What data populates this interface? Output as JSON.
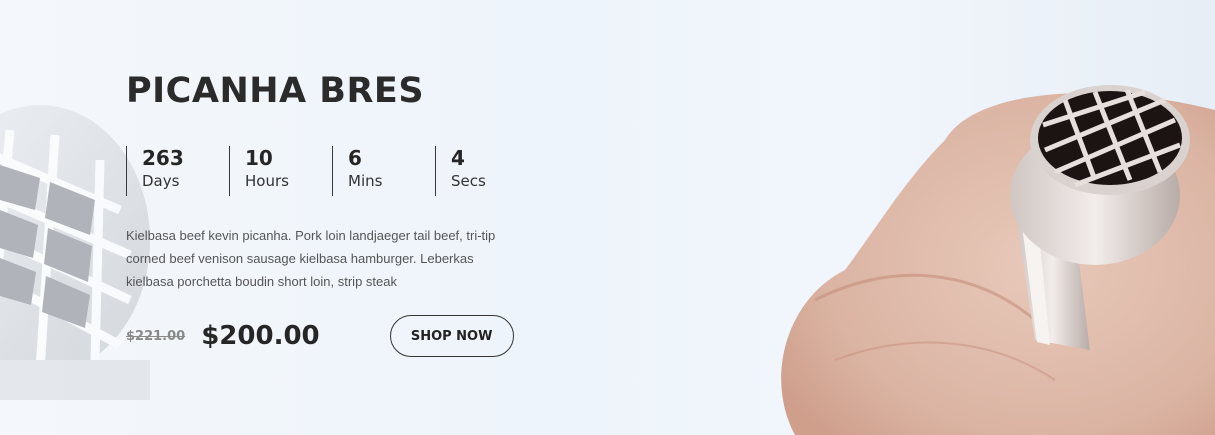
{
  "product": {
    "title": "PICANHA BRES",
    "description": "Kielbasa beef kevin picanha. Pork loin landjaeger tail beef, tri-tip corned beef venison sausage kielbasa hamburger. Leberkas kielbasa porchetta boudin short loin, strip steak",
    "old_price": "$221.00",
    "price": "$200.00",
    "cta_label": "SHOP NOW"
  },
  "countdown": [
    {
      "value": "263",
      "unit": "Days"
    },
    {
      "value": "10",
      "unit": "Hours"
    },
    {
      "value": "6",
      "unit": "Mins"
    },
    {
      "value": "4",
      "unit": "Secs"
    }
  ],
  "colors": {
    "background": "#f3f7fc",
    "text_dark": "#2b2b2b",
    "text_muted": "#555555",
    "old_price": "#8a8a8a"
  },
  "icons": {
    "left_background": "ring-closeup-image",
    "right_background": "ring-on-finger-image"
  }
}
